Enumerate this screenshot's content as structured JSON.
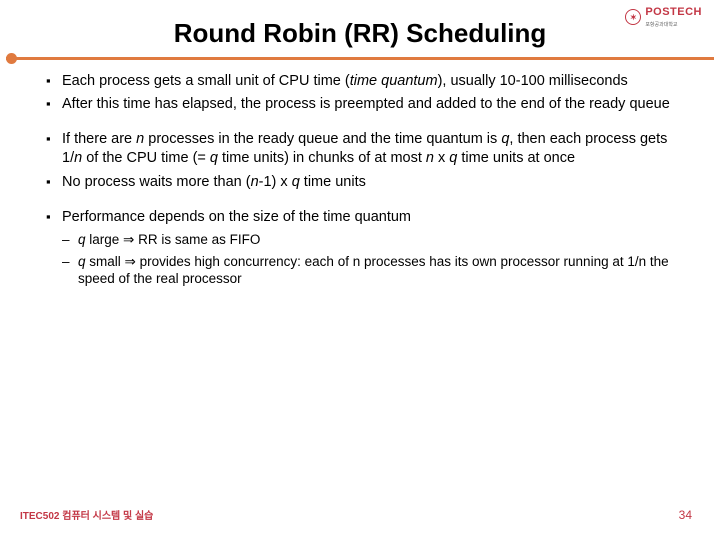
{
  "logo": {
    "brand": "POSTECH",
    "sub": "포항공과대학교"
  },
  "title": "Round Robin (RR) Scheduling",
  "groups": [
    {
      "items": [
        {
          "pre": "Each process gets a small unit of CPU time (",
          "it1": "time quantum",
          "post": "), usually 10-100 milliseconds"
        },
        {
          "text": "After this time has elapsed, the process is preempted and added to the end of the ready queue"
        }
      ]
    },
    {
      "items": [
        {
          "html": "If there are <span class='it'>n</span> processes in the ready queue and the time quantum is <span class='it'>q</span>, then each process gets 1/<span class='it'>n</span> of the CPU time (= <span class='it'>q</span> time units) in chunks of at most <span class='it'>n</span> x <span class='it'>q</span> time units at once"
        },
        {
          "html": "No process waits more than (<span class='it'>n</span>-1) x <span class='it'>q</span> time units"
        }
      ]
    },
    {
      "items": [
        {
          "text": "Performance depends on the size of the time quantum",
          "subs": [
            {
              "html": "<span class='it'>q</span> large ⇒ RR is same as FIFO"
            },
            {
              "html": "<span class='it'>q</span> small ⇒ provides high concurrency: each of n processes has its own processor running at 1/n the speed of the real processor"
            }
          ]
        }
      ]
    }
  ],
  "footer": {
    "left": "ITEC502 컴퓨터 시스템 및 실습",
    "right": "34"
  }
}
